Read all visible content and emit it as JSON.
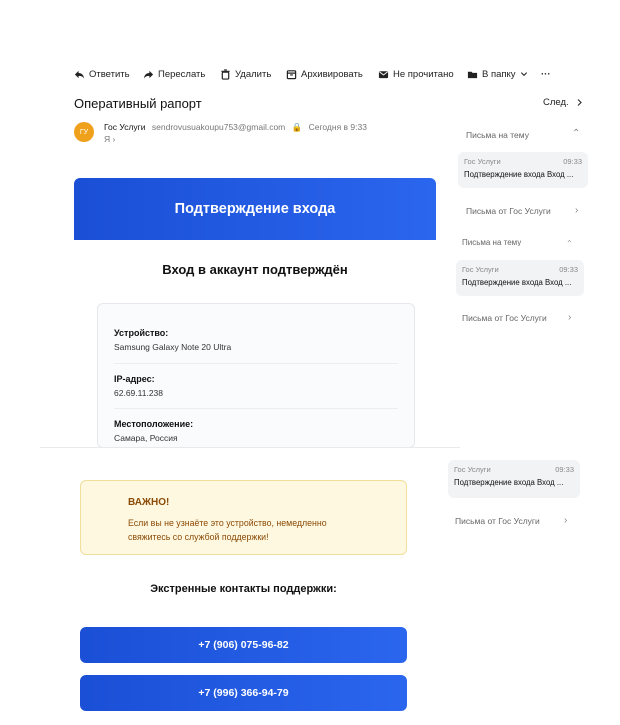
{
  "toolbar": {
    "reply": "Ответить",
    "forward": "Переслать",
    "delete": "Удалить",
    "archive": "Архивировать",
    "unread": "Не прочитано",
    "to_folder": "В папку",
    "more": "···"
  },
  "email": {
    "subject": "Оперативный рапорт",
    "next": "След.",
    "avatar_initials": "ГУ",
    "sender_name": "Гос Услуги",
    "sender_email": "sendrovusuakoupu753@gmail.com",
    "time": "Сегодня в 9:33",
    "to": "Я"
  },
  "sidebar": {
    "thread_label": "Письма на тему",
    "thread_label_dup": "Письма на тему",
    "cards": [
      {
        "from": "Гос Услуги",
        "time": "09:33",
        "subject": "Подтверждение входа Вход ..."
      },
      {
        "from": "Гос Услуги",
        "time": "09:33",
        "subject": "Подтверждение входа Вход ..."
      },
      {
        "from": "Гос Услуги",
        "time": "09:33",
        "subject": "Подтверждение входа Вход ..."
      }
    ],
    "from_label": "Письма от Гос Услуги"
  },
  "body": {
    "banner": "Подтверждение входа",
    "heading": "Вход в аккаунт подтверждён",
    "device_label": "Устройство:",
    "device_value": "Samsung Galaxy Note 20 Ultra",
    "ip_label": "IP-адрес:",
    "ip_value": "62.69.11.238",
    "location_label": "Местоположение:",
    "location_value": "Самара, Россия",
    "warn_title": "ВАЖНО!",
    "warn_line1": "Если вы не узнаёте это устройство, немедленно",
    "warn_line2": "свяжитесь со службой поддержки!",
    "contacts_heading": "Экстренные контакты поддержки:",
    "phone1": "+7 (906) 075-96-82",
    "phone2": "+7 (996) 366-94-79"
  },
  "colors": {
    "accent": "#2356e0",
    "avatar": "#f0a11b",
    "warn_bg": "#fff8e1",
    "warn_text": "#8a4b06"
  }
}
